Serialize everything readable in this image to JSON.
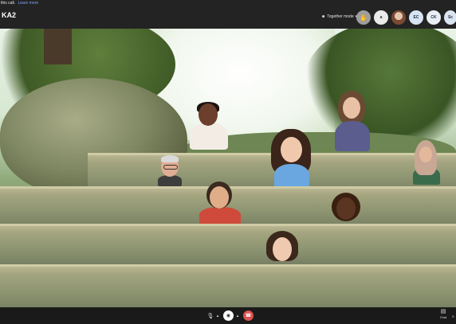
{
  "notice": {
    "text": "this call.",
    "link": "Learn more"
  },
  "meeting": {
    "title": "KA2"
  },
  "header": {
    "together_mode_label": "Together mode",
    "participants": [
      "a",
      "EC",
      "CK",
      "Sc"
    ]
  },
  "bottom": {
    "chat_label": "Chat",
    "more_label": "S"
  },
  "colors": {
    "end_call": "#d9534f",
    "link": "#7fa3ff",
    "topbar": "#232323"
  }
}
